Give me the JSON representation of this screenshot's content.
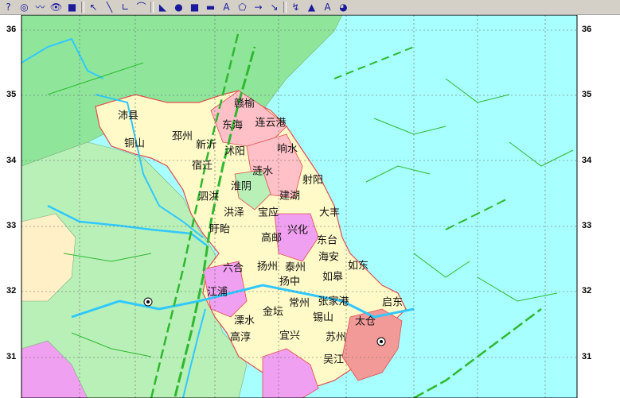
{
  "toolbar": {
    "tools": [
      {
        "name": "help-icon",
        "glyph": "?"
      },
      {
        "name": "target-icon",
        "glyph": "◎"
      },
      {
        "name": "scale-icon",
        "glyph": "〰"
      },
      {
        "name": "eye-icon",
        "glyph": "👁"
      },
      {
        "name": "stop-icon",
        "glyph": "■"
      },
      {
        "name": "pointer-icon",
        "glyph": "↖"
      },
      {
        "name": "line-icon",
        "glyph": "╲"
      },
      {
        "name": "angle-icon",
        "glyph": "∟"
      },
      {
        "name": "arc-icon",
        "glyph": "⌒"
      },
      {
        "name": "fill-region-icon",
        "glyph": "◣"
      },
      {
        "name": "ellipse-icon",
        "glyph": "●"
      },
      {
        "name": "rectangle-icon",
        "glyph": "■"
      },
      {
        "name": "rounded-rect-icon",
        "glyph": "▬"
      },
      {
        "name": "text-icon",
        "glyph": "A"
      },
      {
        "name": "polygon-icon",
        "glyph": "⬠"
      },
      {
        "name": "arrow-icon",
        "glyph": "→"
      },
      {
        "name": "node-edit-icon",
        "glyph": "↘"
      },
      {
        "name": "curve-icon",
        "glyph": "↯"
      },
      {
        "name": "layer-icon",
        "glyph": "▲"
      },
      {
        "name": "text-style-icon",
        "glyph": "A"
      },
      {
        "name": "color-icon",
        "glyph": "◕"
      }
    ]
  },
  "map": {
    "lat_labels": [
      "36",
      "35",
      "34",
      "33",
      "32",
      "31"
    ],
    "cities": [
      {
        "name": "赣榆",
        "key": "ganyu"
      },
      {
        "name": "东海",
        "key": "donghai"
      },
      {
        "name": "连云港",
        "key": "lianyungang"
      },
      {
        "name": "沛县",
        "key": "peixian"
      },
      {
        "name": "邳州",
        "key": "pizhou"
      },
      {
        "name": "铜山",
        "key": "tongshan"
      },
      {
        "name": "新沂",
        "key": "xinyi"
      },
      {
        "name": "沭阳",
        "key": "shuyang"
      },
      {
        "name": "响水",
        "key": "xiangshui"
      },
      {
        "name": "宿迁",
        "key": "suqian"
      },
      {
        "name": "涟水",
        "key": "lianshui"
      },
      {
        "name": "射阳",
        "key": "sheyang"
      },
      {
        "name": "淮阴",
        "key": "huaiyin"
      },
      {
        "name": "建湖",
        "key": "jianhu"
      },
      {
        "name": "泗洪",
        "key": "sihong"
      },
      {
        "name": "洪泽",
        "key": "hongze"
      },
      {
        "name": "宝应",
        "key": "baoying"
      },
      {
        "name": "大丰",
        "key": "dafeng"
      },
      {
        "name": "盱眙",
        "key": "xuyi"
      },
      {
        "name": "兴化",
        "key": "xinghua"
      },
      {
        "name": "高邮",
        "key": "gaoyou"
      },
      {
        "name": "东台",
        "key": "dongtai"
      },
      {
        "name": "海安",
        "key": "haian"
      },
      {
        "name": "六合",
        "key": "liuhe"
      },
      {
        "name": "扬州",
        "key": "yangzhou"
      },
      {
        "name": "泰州",
        "key": "taizhou"
      },
      {
        "name": "如东",
        "key": "rudong"
      },
      {
        "name": "扬中",
        "key": "yangzhong"
      },
      {
        "name": "如皋",
        "key": "rugao"
      },
      {
        "name": "江浦",
        "key": "jiangpu"
      },
      {
        "name": "常州",
        "key": "changzhou"
      },
      {
        "name": "张家港",
        "key": "zhangjiagang"
      },
      {
        "name": "启东",
        "key": "qidong"
      },
      {
        "name": "金坛",
        "key": "jintan"
      },
      {
        "name": "锡山",
        "key": "xishan"
      },
      {
        "name": "太仓",
        "key": "taicang"
      },
      {
        "name": "溧水",
        "key": "lishui"
      },
      {
        "name": "高淳",
        "key": "gaochun"
      },
      {
        "name": "宜兴",
        "key": "yixing"
      },
      {
        "name": "苏州",
        "key": "suzhou"
      },
      {
        "name": "吴江",
        "key": "wujiang"
      }
    ],
    "colors": {
      "sea": "#a8ffff",
      "land_green": "#8fe69a",
      "land_pale": "#b8f0b8",
      "land_orange": "#fff0c8",
      "jiangsu_pink": "#ffc0c8",
      "jiangsu_yellow": "#fffac8",
      "magenta": "#f0a0f0",
      "river": "#30c8ff",
      "fault": "#2fb82f",
      "border": "#e05050",
      "grid": "#606060"
    }
  }
}
